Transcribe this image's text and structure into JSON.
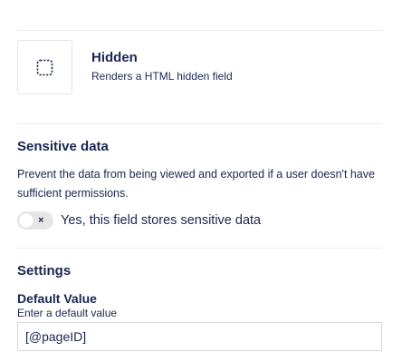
{
  "field_type": {
    "icon": "dashed-square-icon",
    "title": "Hidden",
    "description": "Renders a HTML hidden field"
  },
  "sensitive": {
    "title": "Sensitive data",
    "description": "Prevent the data from being viewed and exported if a user doesn't have sufficient permissions.",
    "toggle_label": "Yes, this field stores sensitive data",
    "toggle_on": false,
    "toggle_off_glyph": "×"
  },
  "settings": {
    "title": "Settings",
    "default_value": {
      "label": "Default Value",
      "description": "Enter a default value",
      "value": "[@pageID]"
    }
  },
  "colors": {
    "text": "#1b264f",
    "divider": "#ececec",
    "toggle_off": "#e6e6e6"
  }
}
